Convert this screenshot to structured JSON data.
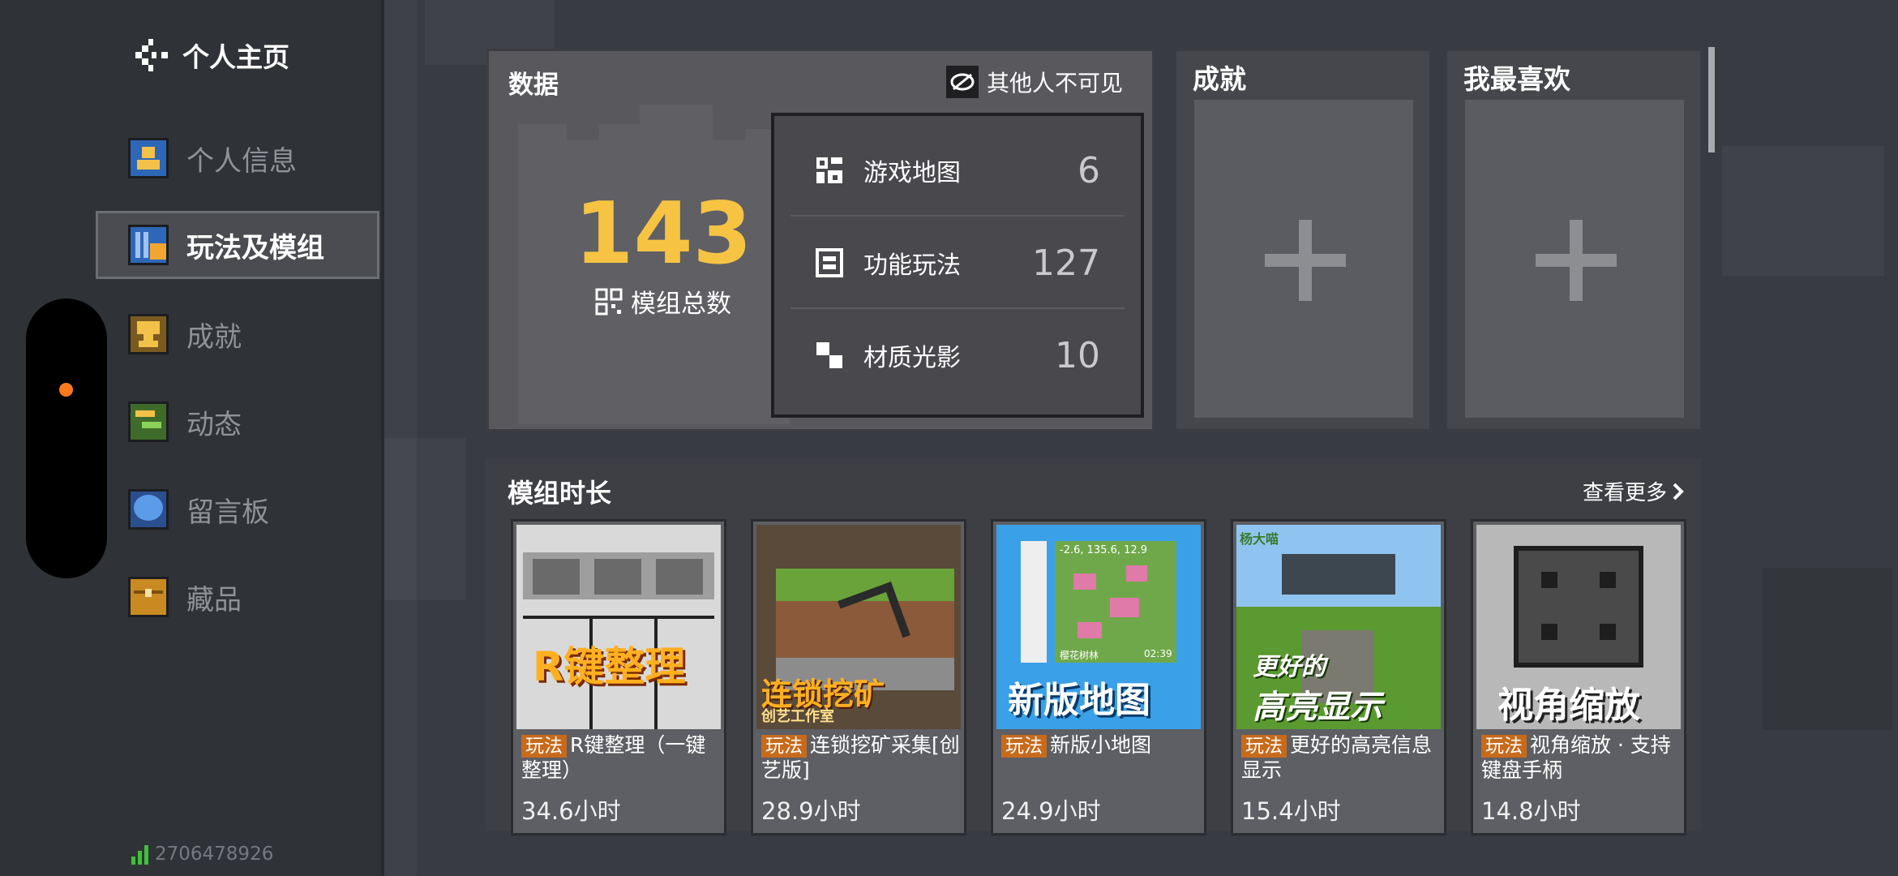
{
  "header": {
    "title": "个人主页",
    "back_icon": "back-icon"
  },
  "sidebar": {
    "items": [
      {
        "label": "个人信息",
        "icon": "profile-icon",
        "active": false
      },
      {
        "label": "玩法及模组",
        "icon": "mods-icon",
        "active": true
      },
      {
        "label": "成就",
        "icon": "trophy-icon",
        "active": false
      },
      {
        "label": "动态",
        "icon": "activity-icon",
        "active": false
      },
      {
        "label": "留言板",
        "icon": "message-icon",
        "active": false
      },
      {
        "label": "藏品",
        "icon": "chest-icon",
        "active": false
      }
    ],
    "user_id": "2706478926"
  },
  "data_panel": {
    "title": "数据",
    "privacy_label": "其他人不可见",
    "total_value": "143",
    "total_label": "模组总数",
    "stats": [
      {
        "label": "游戏地图",
        "value": "6",
        "icon": "map-icon"
      },
      {
        "label": "功能玩法",
        "value": "127",
        "icon": "gameplay-icon"
      },
      {
        "label": "材质光影",
        "value": "10",
        "icon": "texture-icon"
      }
    ]
  },
  "achievements_panel": {
    "title": "成就"
  },
  "favorites_panel": {
    "title": "我最喜欢"
  },
  "mods_panel": {
    "title": "模组时长",
    "more_label": "查看更多",
    "cards": [
      {
        "tag": "玩法",
        "name": "R键整理（一键整理）",
        "hours": "34.6小时",
        "thumb_text": "R键整理"
      },
      {
        "tag": "玩法",
        "name": "连锁挖矿采集[创艺版]",
        "hours": "28.9小时",
        "thumb_text": "连锁挖矿",
        "thumb_sub": "创艺工作室"
      },
      {
        "tag": "玩法",
        "name": "新版小地图",
        "hours": "24.9小时",
        "thumb_text": "新版地图",
        "thumb_coords": "-2.6, 135.6, 12.9",
        "thumb_biome": "樱花树林",
        "thumb_time": "02:39"
      },
      {
        "tag": "玩法",
        "name": "更好的高亮信息显示",
        "hours": "15.4小时",
        "thumb_text": "更好的",
        "thumb_text2": "高亮显示",
        "thumb_top": "杨大喵"
      },
      {
        "tag": "玩法",
        "name": "视角缩放 · 支持键盘手柄",
        "hours": "14.8小时",
        "thumb_text": "视角缩放"
      }
    ]
  },
  "colors": {
    "accent": "#f6c343",
    "tag": "#c76a1c",
    "status_dot": "#ff7a1a"
  }
}
